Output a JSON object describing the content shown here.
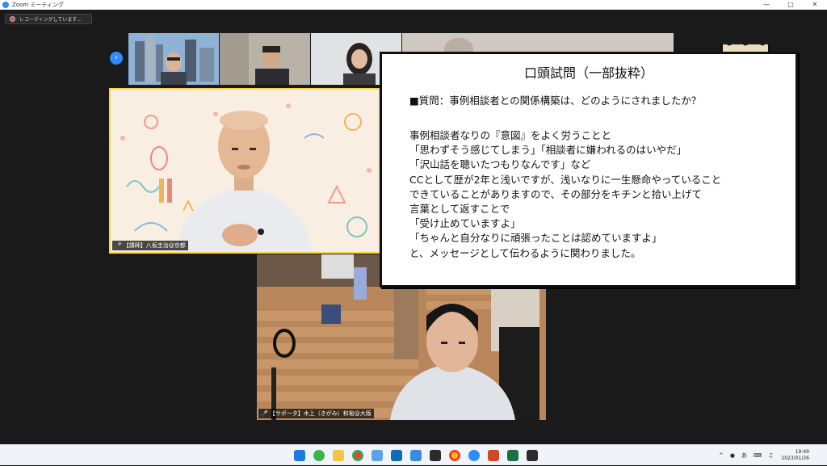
{
  "window": {
    "title": "Zoom ミーティング"
  },
  "recording": {
    "label": "レコーディングしています..."
  },
  "participants": {
    "main": {
      "name": "【講師】八坂圭治@京都"
    },
    "bottom": {
      "name": "【サポータ】木上（きがみ）和裕@大阪"
    }
  },
  "note": {
    "title": "口頭試問（一部抜粋）",
    "question": "■質問：事例相談者との関係構築は、どのようにされましたか？",
    "lines": [
      "事例相談者なりの『意図』をよく労うことと",
      "「思わずそう感じてしまう」「相談者に嫌われるのはいやだ」",
      "「沢山話を聴いたつもりなんです」など",
      "CCとして歴が2年と浅いですが、浅いなりに一生懸命やっていること",
      "できていることがありますので、その部分をキチンと拾い上げて",
      "言葉として返すことで",
      "「受け止めていますよ」",
      "「ちゃんと自分なりに頑張ったことは認めていますよ」",
      "と、メッセージとして伝わるように関わりました。"
    ]
  },
  "taskbar": {
    "time": "19:49",
    "date": "2023/01/26",
    "ime": "あ"
  },
  "colors": {
    "accent": "#2d8cff",
    "active_speaker": "#f5d64a"
  }
}
